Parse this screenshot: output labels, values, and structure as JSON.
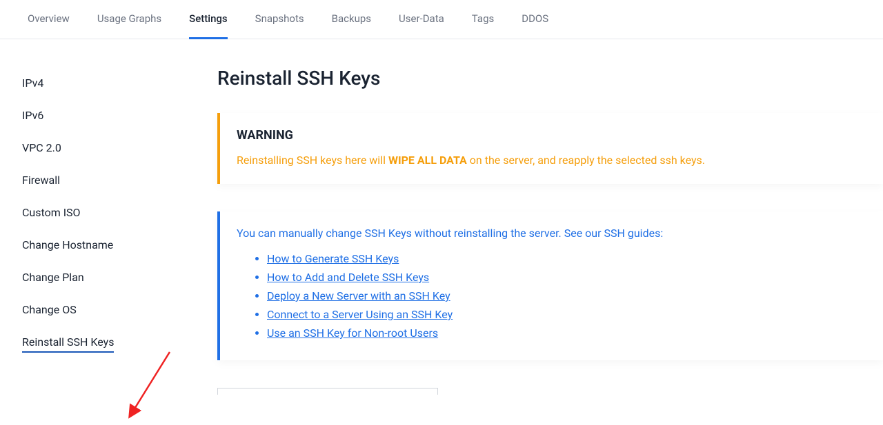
{
  "tabs": [
    {
      "label": "Overview"
    },
    {
      "label": "Usage Graphs"
    },
    {
      "label": "Settings"
    },
    {
      "label": "Snapshots"
    },
    {
      "label": "Backups"
    },
    {
      "label": "User-Data"
    },
    {
      "label": "Tags"
    },
    {
      "label": "DDOS"
    }
  ],
  "sidebar": [
    {
      "label": "IPv4"
    },
    {
      "label": "IPv6"
    },
    {
      "label": "VPC 2.0"
    },
    {
      "label": "Firewall"
    },
    {
      "label": "Custom ISO"
    },
    {
      "label": "Change Hostname"
    },
    {
      "label": "Change Plan"
    },
    {
      "label": "Change OS"
    },
    {
      "label": "Reinstall SSH Keys"
    }
  ],
  "page": {
    "title": "Reinstall SSH Keys"
  },
  "warning": {
    "title": "WARNING",
    "prefix": "Reinstalling SSH keys here will ",
    "emphasis": "WIPE ALL DATA",
    "suffix": " on the server, and reapply the selected ssh keys."
  },
  "info": {
    "intro": "You can manually change SSH Keys without reinstalling the server. See our SSH guides:",
    "links": [
      "How to Generate SSH Keys",
      "How to Add and Delete SSH Keys",
      "Deploy a New Server with an SSH Key",
      "Connect to a Server Using an SSH Key",
      "Use an SSH Key for Non-root Users"
    ]
  }
}
